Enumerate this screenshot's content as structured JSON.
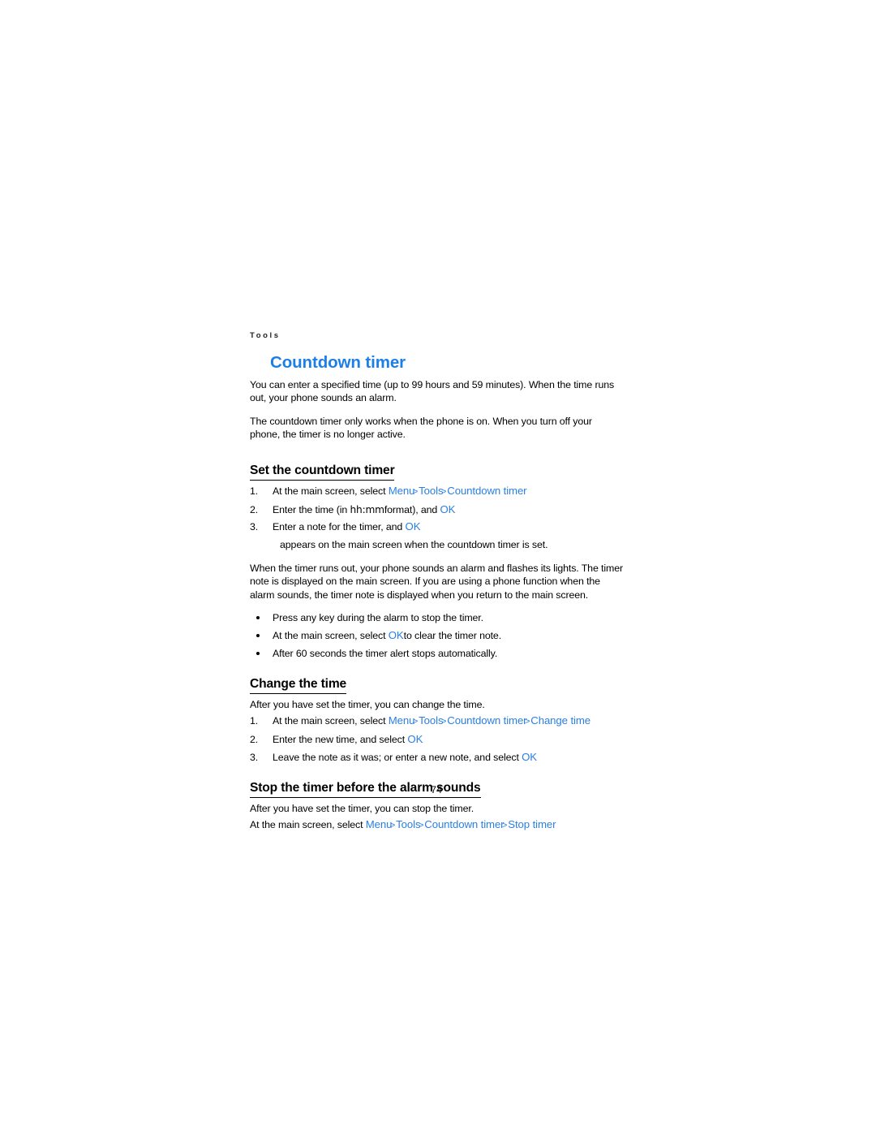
{
  "page": {
    "running_header": "Tools",
    "page_number": "74",
    "accent_color": "#1c7fe8",
    "link_color": "#2a7fe3",
    "text_color": "#000000",
    "background_color": "#ffffff"
  },
  "chapter": {
    "title": "Countdown timer",
    "intro_paragraph_1": "You can enter a specified time (up to 99 hours and 59 minutes). When the time runs out, your phone sounds an alarm.",
    "intro_paragraph_2": "The countdown timer only works when the phone is on. When you turn off your phone, the timer is no longer active."
  },
  "sections": [
    {
      "heading": "Set the countdown timer",
      "steps": [
        {
          "number": "1.",
          "lead": "At the main screen, select ",
          "path": [
            "Menu",
            "Tools",
            "Countdown timer"
          ],
          "separator": ">",
          "trail": ""
        },
        {
          "number": "2.",
          "lead": "Enter the time (in ",
          "mono": "hh:mm",
          "mid": "format), and ",
          "link": "OK",
          "trail": ""
        },
        {
          "number": "3.",
          "lead": "Enter a note for the timer, and ",
          "link": "OK",
          "trail": ""
        }
      ],
      "continuation": "appears on the main screen when the countdown timer is set.",
      "paragraph": "When the timer runs out, your phone sounds an alarm and flashes its lights. The timer note is displayed on the main screen. If you are using a phone function when the alarm sounds, the timer note is displayed when you return to the main screen.",
      "bullets": [
        {
          "lead": "Press any key during the alarm to stop the timer.",
          "link": "",
          "trail": ""
        },
        {
          "lead": "At the main screen, select ",
          "link": "OK",
          "trail": "to clear the timer note."
        },
        {
          "lead": "After 60 seconds the timer alert stops automatically.",
          "link": "",
          "trail": ""
        }
      ]
    },
    {
      "heading": "Change the time",
      "intro": "After you have set the timer, you can change the time.",
      "steps": [
        {
          "number": "1.",
          "lead": "At the main screen, select ",
          "path": [
            "Menu",
            "Tools",
            "Countdown timer",
            "Change time"
          ],
          "separator": ">",
          "trail": ""
        },
        {
          "number": "2.",
          "lead": "Enter the new time, and select ",
          "link": "OK",
          "trail": ""
        },
        {
          "number": "3.",
          "lead": "Leave the note as it was; or enter a new note, and select ",
          "link": "OK",
          "trail": ""
        }
      ]
    },
    {
      "heading": "Stop the timer before the alarm sounds",
      "intro": "After you have set the timer, you can stop the timer.",
      "final_line": {
        "lead": "At the main screen, select ",
        "path": [
          "Menu",
          "Tools",
          "Countdown timer",
          "Stop timer"
        ],
        "separator": ">"
      }
    }
  ]
}
